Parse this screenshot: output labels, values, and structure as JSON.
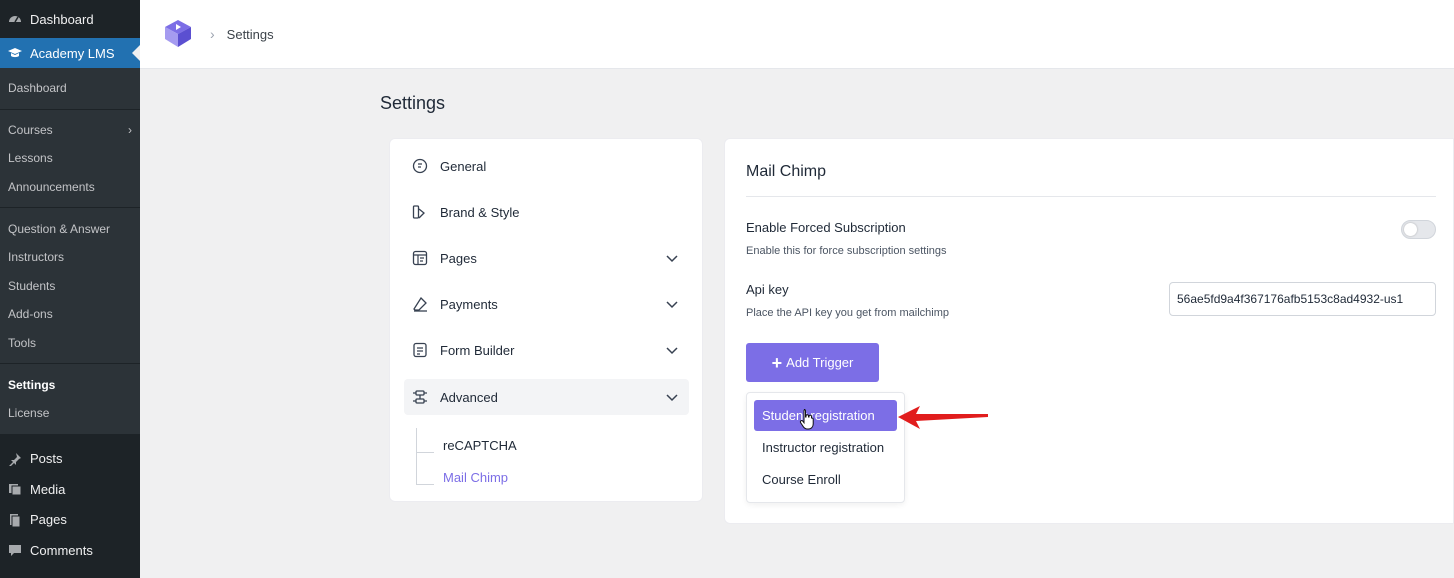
{
  "wp_sidebar": {
    "dashboard": "Dashboard",
    "active_menu": "Academy LMS",
    "submenu": [
      {
        "label": "Dashboard"
      },
      {
        "label": "Courses"
      },
      {
        "label": "Lessons"
      },
      {
        "label": "Announcements"
      },
      {
        "label": "Question & Answer"
      },
      {
        "label": "Instructors"
      },
      {
        "label": "Students"
      },
      {
        "label": "Add-ons"
      },
      {
        "label": "Tools"
      },
      {
        "label": "Settings"
      },
      {
        "label": "License"
      }
    ],
    "menu": [
      {
        "label": "Posts",
        "icon": "pin-icon"
      },
      {
        "label": "Media",
        "icon": "media-icon"
      },
      {
        "label": "Pages",
        "icon": "pages-icon"
      },
      {
        "label": "Comments",
        "icon": "comments-icon"
      }
    ]
  },
  "header": {
    "breadcrumb": "Settings"
  },
  "page": {
    "title": "Settings"
  },
  "settings_nav": {
    "items": [
      {
        "label": "General"
      },
      {
        "label": "Brand & Style"
      },
      {
        "label": "Pages"
      },
      {
        "label": "Payments"
      },
      {
        "label": "Form Builder"
      },
      {
        "label": "Advanced"
      }
    ],
    "sub_items": [
      {
        "label": "reCAPTCHA"
      },
      {
        "label": "Mail Chimp"
      }
    ]
  },
  "mailchimp": {
    "title": "Mail Chimp",
    "forced": {
      "label": "Enable Forced Subscription",
      "help": "Enable this for force subscription settings",
      "enabled": false
    },
    "api": {
      "label": "Api key",
      "help": "Place the API key you get from mailchimp",
      "value": "56ae5fd9a4f367176afb5153c8ad4932-us1"
    },
    "add_trigger": "Add Trigger",
    "trigger_options": [
      {
        "label": "Student registration"
      },
      {
        "label": "Instructor registration"
      },
      {
        "label": "Course Enroll"
      }
    ]
  },
  "colors": {
    "accent": "#7c6ee6",
    "wp_blue": "#2271b1",
    "wp_dark": "#1d2327",
    "annotation_arrow": "#e11d1d"
  }
}
